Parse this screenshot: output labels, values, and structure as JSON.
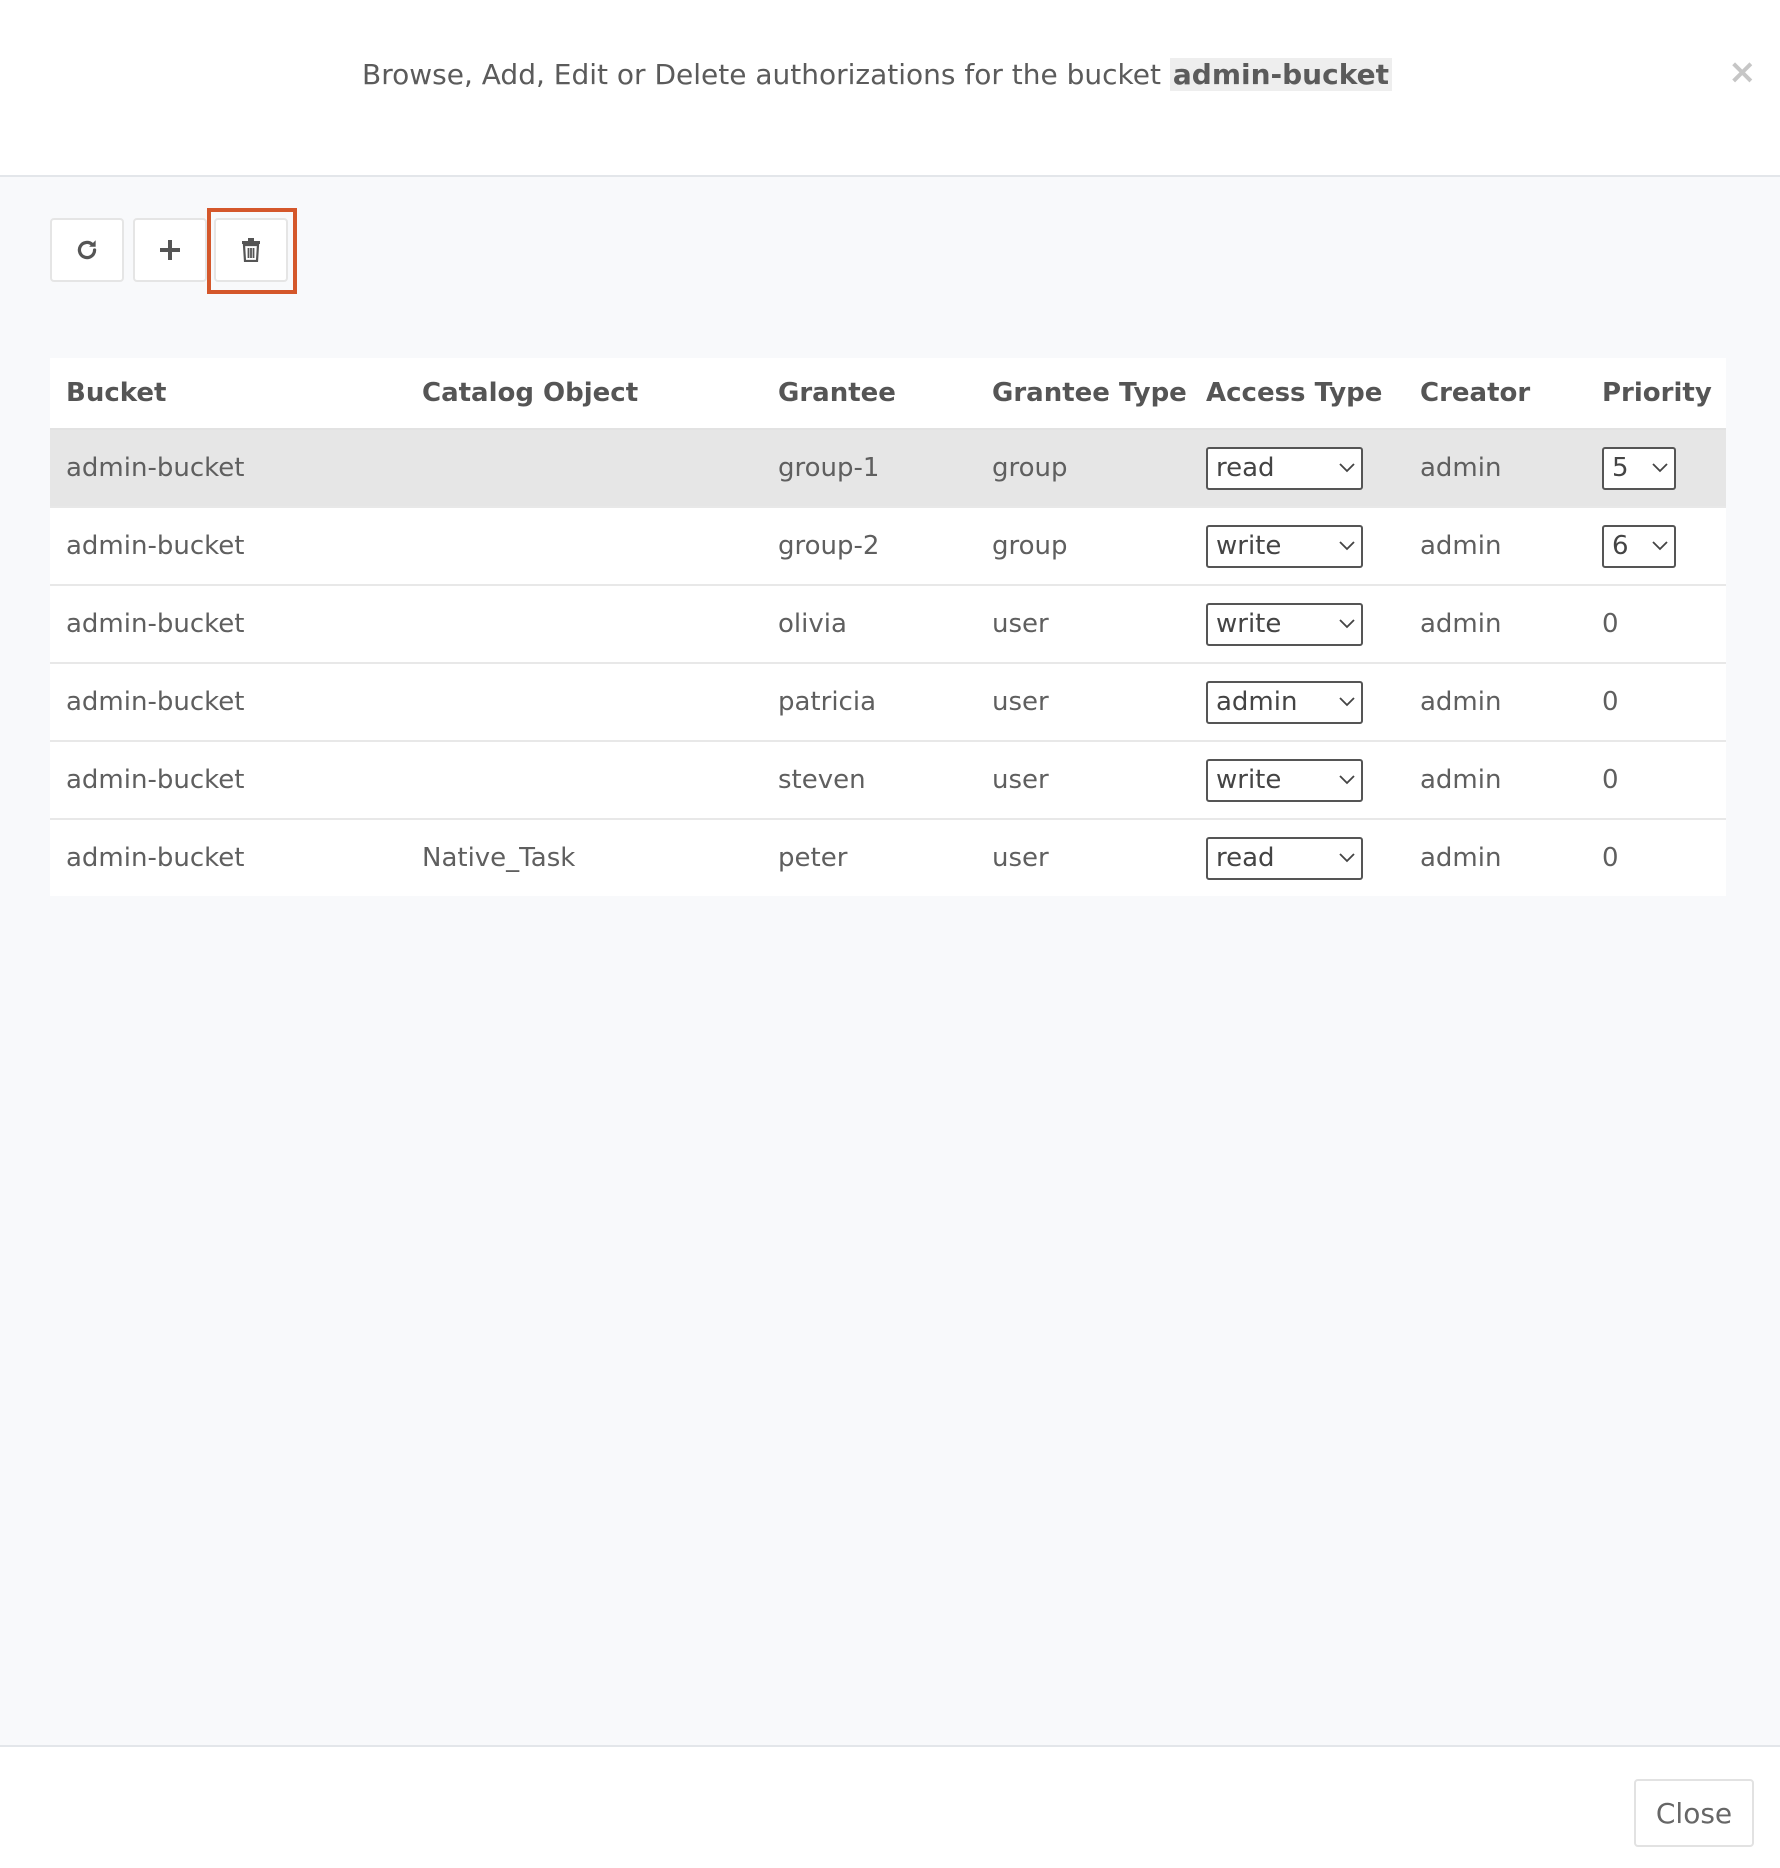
{
  "header": {
    "title_prefix": "Browse, Add, Edit or Delete authorizations for the bucket",
    "bucket_name": "admin-bucket",
    "close_icon": "close-icon"
  },
  "toolbar": {
    "refresh_icon": "refresh-icon",
    "add_icon": "plus-icon",
    "delete_icon": "trash-icon",
    "highlight_color": "#d4572b"
  },
  "table": {
    "headers": [
      "Bucket",
      "Catalog Object",
      "Grantee",
      "Grantee Type",
      "Access Type",
      "Creator",
      "Priority"
    ],
    "rows": [
      {
        "bucket": "admin-bucket",
        "catalog_object": "",
        "grantee": "group-1",
        "grantee_type": "group",
        "access_type": "read",
        "creator": "admin",
        "priority": "5",
        "priority_editable": true,
        "selected": true
      },
      {
        "bucket": "admin-bucket",
        "catalog_object": "",
        "grantee": "group-2",
        "grantee_type": "group",
        "access_type": "write",
        "creator": "admin",
        "priority": "6",
        "priority_editable": true,
        "selected": false
      },
      {
        "bucket": "admin-bucket",
        "catalog_object": "",
        "grantee": "olivia",
        "grantee_type": "user",
        "access_type": "write",
        "creator": "admin",
        "priority": "0",
        "priority_editable": false,
        "selected": false
      },
      {
        "bucket": "admin-bucket",
        "catalog_object": "",
        "grantee": "patricia",
        "grantee_type": "user",
        "access_type": "admin",
        "creator": "admin",
        "priority": "0",
        "priority_editable": false,
        "selected": false
      },
      {
        "bucket": "admin-bucket",
        "catalog_object": "",
        "grantee": "steven",
        "grantee_type": "user",
        "access_type": "write",
        "creator": "admin",
        "priority": "0",
        "priority_editable": false,
        "selected": false
      },
      {
        "bucket": "admin-bucket",
        "catalog_object": "Native_Task",
        "grantee": "peter",
        "grantee_type": "user",
        "access_type": "read",
        "creator": "admin",
        "priority": "0",
        "priority_editable": false,
        "selected": false
      }
    ]
  },
  "footer": {
    "close_label": "Close"
  }
}
